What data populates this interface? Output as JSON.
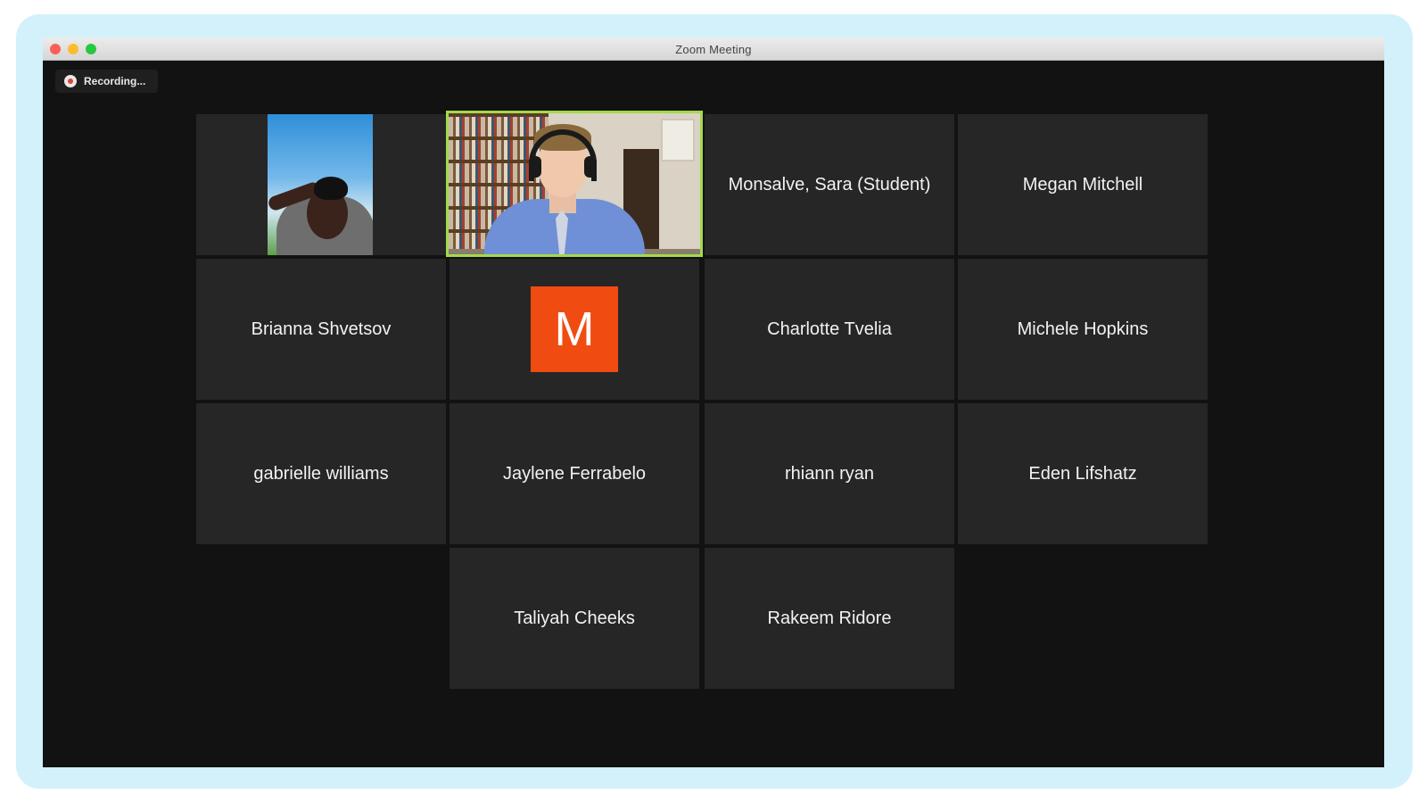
{
  "window": {
    "title": "Zoom Meeting"
  },
  "recording": {
    "label": "Recording...",
    "icon": "record-stop-icon"
  },
  "participants": [
    {
      "name": "",
      "type": "video",
      "active": false
    },
    {
      "name": "",
      "type": "video",
      "active": true
    },
    {
      "name": "Monsalve, Sara (Student)",
      "type": "name"
    },
    {
      "name": "Megan Mitchell",
      "type": "name"
    },
    {
      "name": "Brianna Shvetsov",
      "type": "name"
    },
    {
      "name": "",
      "type": "avatar",
      "avatar_letter": "M",
      "avatar_color": "#f04c12"
    },
    {
      "name": "Charlotte Tvelia",
      "type": "name"
    },
    {
      "name": "Michele Hopkins",
      "type": "name"
    },
    {
      "name": "gabrielle williams",
      "type": "name"
    },
    {
      "name": "Jaylene Ferrabelo",
      "type": "name"
    },
    {
      "name": "rhiann ryan",
      "type": "name"
    },
    {
      "name": "Eden Lifshatz",
      "type": "name"
    },
    {
      "name": "Taliyah Cheeks",
      "type": "name"
    },
    {
      "name": "Rakeem Ridore",
      "type": "name"
    }
  ],
  "colors": {
    "active_speaker_border": "#a4d94d",
    "tile_background": "#262626",
    "meeting_background": "#121212",
    "frame": "#d3f1fa"
  }
}
